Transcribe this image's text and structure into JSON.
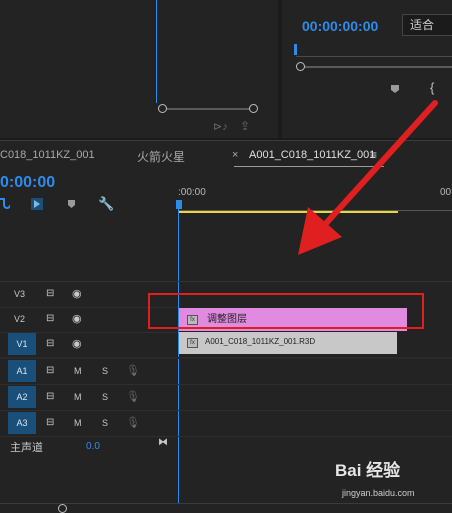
{
  "program_monitor": {
    "timecode": "00:00:00:00",
    "fit_label": "适合"
  },
  "timeline": {
    "tabs": [
      "C018_1011KZ_001",
      "火箭火星",
      "A001_C018_1011KZ_001"
    ],
    "close_glyph": "×",
    "menu_glyph": "≡",
    "timecode": "0:00:00",
    "ruler_start": ":00:00",
    "ruler_end": "00",
    "tracks": {
      "v3": "V3",
      "v2": "V2",
      "v1": "V1",
      "a1": "A1",
      "a2": "A2",
      "a3": "A3"
    },
    "mute_label": "M",
    "solo_label": "S",
    "master_label": "主声道",
    "master_value": "0.0",
    "clips": {
      "adjustment_layer": "调整图层",
      "video_clip": "A001_C018_1011KZ_001.R3D",
      "fx_badge": "fx"
    },
    "colors": {
      "timecode": "#2d8ceb",
      "adjustment_clip": "#e08ae0",
      "video_clip": "#c8c8c8",
      "highlight_box": "#e02020",
      "arrow": "#e02020",
      "work_area": "#e6d93b"
    }
  },
  "watermark": {
    "brand": "Bai 经验",
    "url": "jingyan.baidu.com"
  }
}
